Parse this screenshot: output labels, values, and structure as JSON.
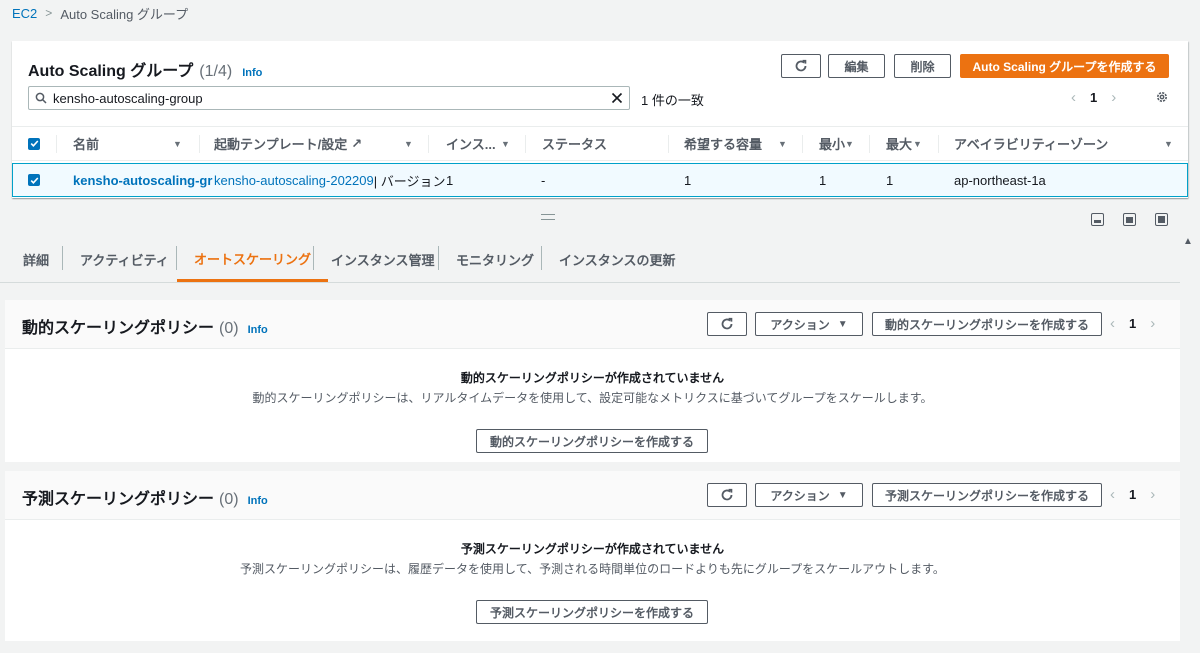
{
  "breadcrumb": {
    "root": "EC2",
    "current": "Auto Scaling グループ"
  },
  "asg": {
    "title": "Auto Scaling グループ",
    "count": "(1/4)",
    "info": "Info",
    "edit_label": "編集",
    "delete_label": "削除",
    "create_label": "Auto Scaling グループを作成する",
    "search_value": "kensho-autoscaling-group",
    "match_text": "1 件の一致",
    "page": "1",
    "columns": [
      "名前",
      "起動テンプレート/設定",
      "インス...",
      "ステータス",
      "希望する容量",
      "最小",
      "最大",
      "アベイラビリティーゾーン"
    ],
    "row": {
      "name": "kensho-autoscaling-gr",
      "template": "kensho-autoscaling-202209",
      "template_suffix": " | バージョン",
      "instances": "1",
      "status": "-",
      "desired": "1",
      "min": "1",
      "max": "1",
      "az": "ap-northeast-1a"
    }
  },
  "tabs": [
    {
      "label": "詳細",
      "active": false
    },
    {
      "label": "アクティビティ",
      "active": false
    },
    {
      "label": "オートスケーリング",
      "active": true
    },
    {
      "label": "インスタンス管理",
      "active": false
    },
    {
      "label": "モニタリング",
      "active": false
    },
    {
      "label": "インスタンスの更新",
      "active": false
    }
  ],
  "dynamic": {
    "title": "動的スケーリングポリシー",
    "count": "(0)",
    "info": "Info",
    "action_label": "アクション",
    "create_label": "動的スケーリングポリシーを作成する",
    "page": "1",
    "empty_title": "動的スケーリングポリシーが作成されていません",
    "empty_desc": "動的スケーリングポリシーは、リアルタイムデータを使用して、設定可能なメトリクスに基づいてグループをスケールします。",
    "empty_button": "動的スケーリングポリシーを作成する"
  },
  "predictive": {
    "title": "予測スケーリングポリシー",
    "count": "(0)",
    "info": "Info",
    "action_label": "アクション",
    "create_label": "予測スケーリングポリシーを作成する",
    "page": "1",
    "empty_title": "予測スケーリングポリシーが作成されていません",
    "empty_desc": "予測スケーリングポリシーは、履歴データを使用して、予測される時間単位のロードよりも先にグループをスケールアウトします。",
    "empty_button": "予測スケーリングポリシーを作成する"
  },
  "colors": {
    "accent": "#ec7211",
    "link": "#0073bb",
    "selected_row": "#f1faff"
  }
}
